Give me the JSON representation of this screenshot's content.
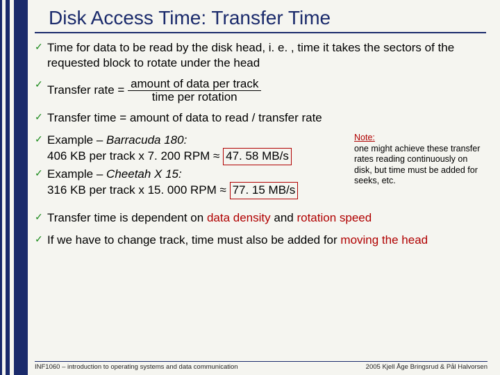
{
  "title": "Disk Access Time: Transfer Time",
  "bullets": {
    "b1": "Time for data to be read by the disk head, i. e. , time it takes the sectors of the requested block to rotate under the head",
    "b2_pre": "Transfer rate = ",
    "b2_num": "amount of data per track",
    "b2_den": "time per rotation",
    "b3": "Transfer time = amount of data to read / transfer rate",
    "ex1_lead": "Example – ",
    "ex1_name": "Barracuda 180: ",
    "ex1_calc": "406 KB per track x 7. 200 RPM ≈ ",
    "ex1_box": "47. 58 MB/s",
    "ex2_lead": "Example – ",
    "ex2_name": "Cheetah X 15: ",
    "ex2_calc": "316 KB per track x 15. 000 RPM ≈ ",
    "ex2_box": "77. 15 MB/s",
    "b6_a": "Transfer time is dependent on ",
    "b6_dd": "data density",
    "b6_b": " and ",
    "b6_rs": "rotation speed",
    "b7_a": "If we have to change track, time must also be added for ",
    "b7_m": "moving the head"
  },
  "note": {
    "head": "Note:",
    "body": "one might achieve these transfer rates reading continuously on disk, but time must be added for seeks, etc."
  },
  "footer": {
    "left": "INF1060 – introduction to operating systems and data communication",
    "right": "2005  Kjell Åge Bringsrud & Pål Halvorsen"
  }
}
